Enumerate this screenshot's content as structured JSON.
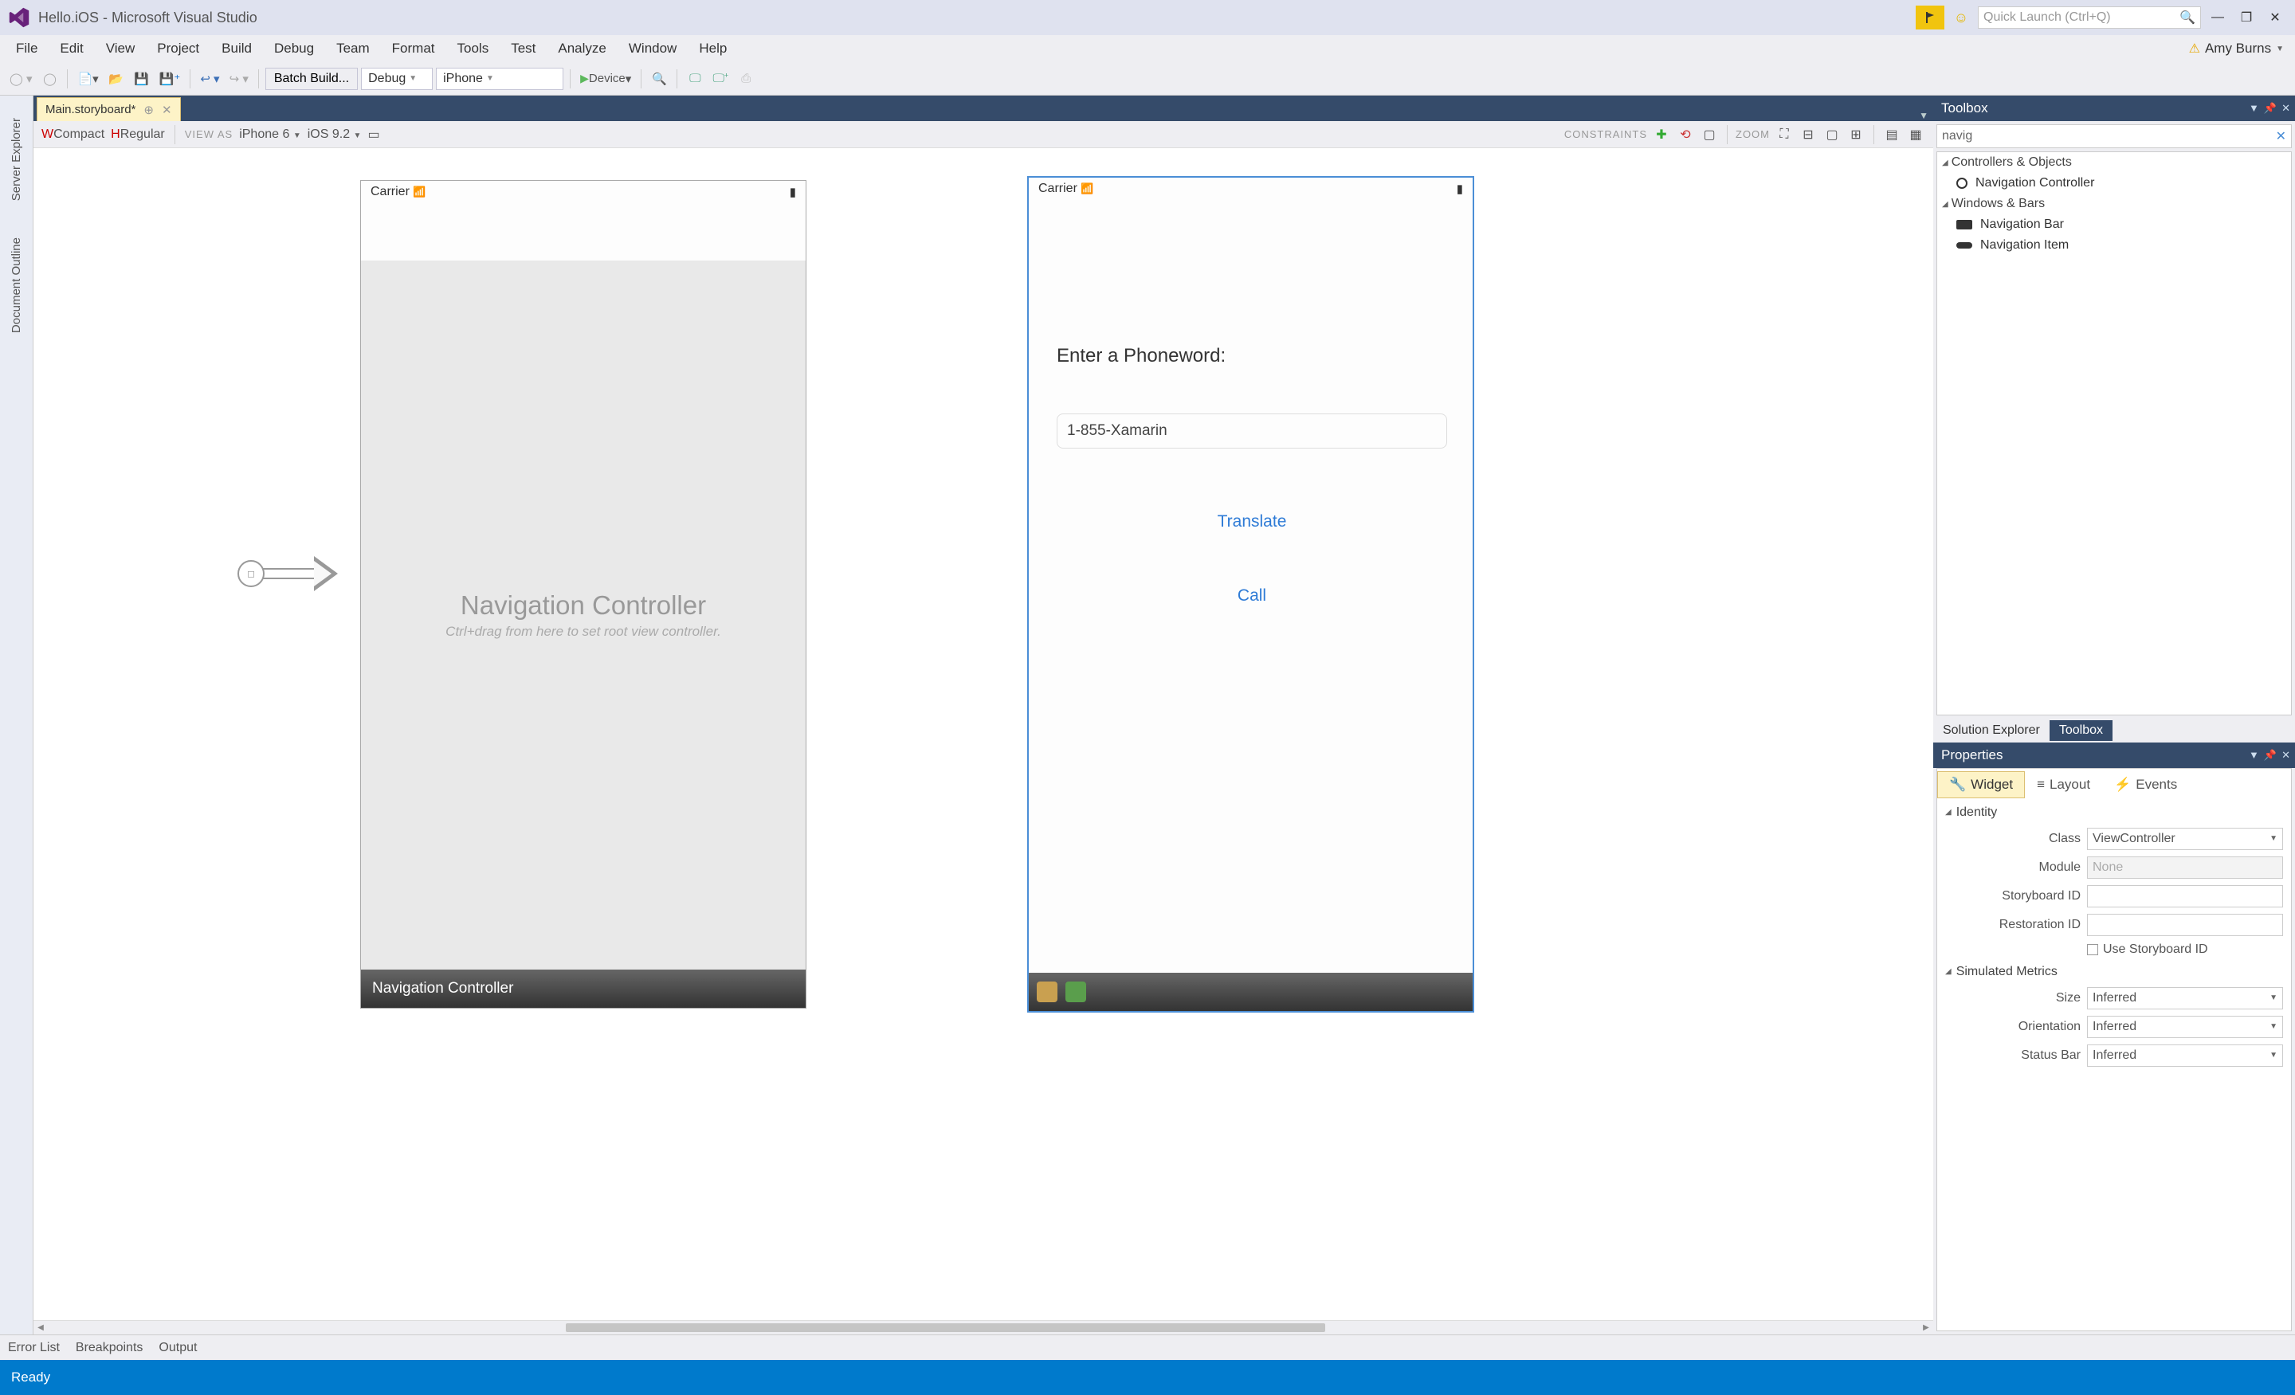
{
  "title": "Hello.iOS - Microsoft Visual Studio",
  "quick_launch_placeholder": "Quick Launch (Ctrl+Q)",
  "user_name": "Amy Burns",
  "menu": [
    "File",
    "Edit",
    "View",
    "Project",
    "Build",
    "Debug",
    "Team",
    "Format",
    "Tools",
    "Test",
    "Analyze",
    "Window",
    "Help"
  ],
  "toolbar": {
    "batch": "Batch Build...",
    "config": "Debug",
    "target": "iPhone",
    "device": "Device"
  },
  "side_rails": [
    "Server Explorer",
    "Document Outline"
  ],
  "doc_tab": "Main.storyboard*",
  "designer": {
    "wcompact": "WCompact",
    "hregular": "HRegular",
    "view_as": "VIEW AS",
    "device": "iPhone 6",
    "ios": "iOS 9.2",
    "constraints": "CONSTRAINTS",
    "zoom": "ZOOM"
  },
  "canvas": {
    "carrier": "Carrier",
    "nav_title": "Navigation Controller",
    "nav_sub": "Ctrl+drag from here to set root view controller.",
    "nav_bar_label": "Navigation Controller",
    "form": {
      "label": "Enter a Phoneword:",
      "input": "1-855-Xamarin",
      "btn1": "Translate",
      "btn2": "Call"
    }
  },
  "toolbox": {
    "title": "Toolbox",
    "search": "navig",
    "group1": "Controllers & Objects",
    "item1": "Navigation Controller",
    "group2": "Windows & Bars",
    "item2": "Navigation Bar",
    "item3": "Navigation Item"
  },
  "panel_tabs": {
    "se": "Solution Explorer",
    "tb": "Toolbox"
  },
  "properties": {
    "title": "Properties",
    "modes": {
      "widget": "Widget",
      "layout": "Layout",
      "events": "Events"
    },
    "section1": "Identity",
    "class_lbl": "Class",
    "class_val": "ViewController",
    "module_lbl": "Module",
    "module_ph": "None",
    "sbid_lbl": "Storyboard ID",
    "restid_lbl": "Restoration ID",
    "use_sbid": "Use Storyboard ID",
    "section2": "Simulated Metrics",
    "size_lbl": "Size",
    "size_val": "Inferred",
    "orient_lbl": "Orientation",
    "orient_val": "Inferred",
    "statusbar_lbl": "Status Bar",
    "statusbar_val": "Inferred"
  },
  "bottom_tabs": [
    "Error List",
    "Breakpoints",
    "Output"
  ],
  "status": "Ready"
}
